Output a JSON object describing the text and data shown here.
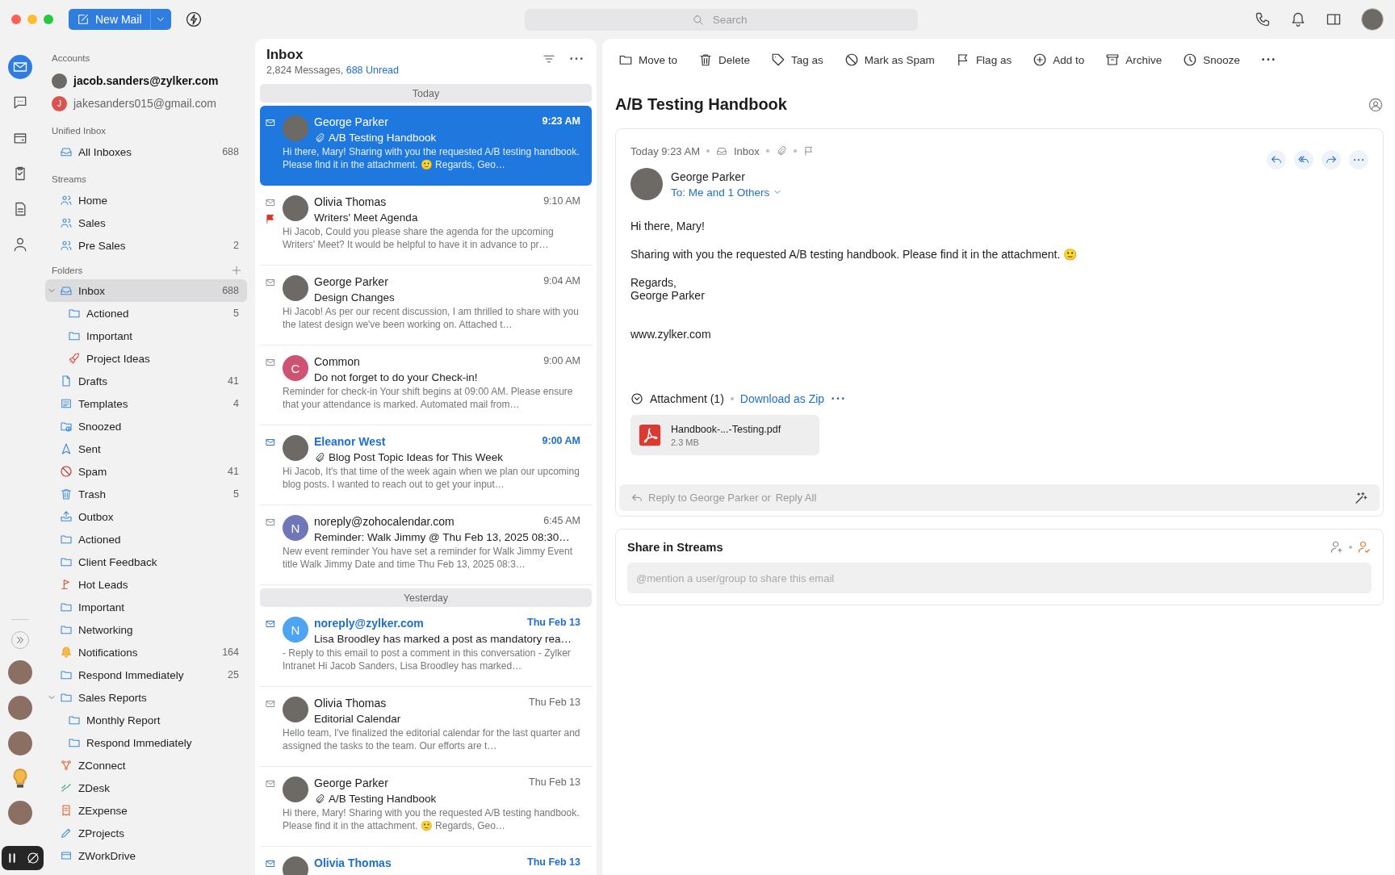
{
  "window": {
    "new_mail": "New Mail",
    "search_placeholder": "Search"
  },
  "rail": [
    {
      "kind": "mail",
      "selected": true
    },
    {
      "kind": "chat",
      "selected": false
    },
    {
      "kind": "calendar",
      "selected": false
    },
    {
      "kind": "tasks",
      "selected": false
    },
    {
      "kind": "notes",
      "selected": false
    },
    {
      "kind": "contacts",
      "selected": false
    }
  ],
  "accounts": {
    "heading": "Accounts",
    "items": [
      {
        "email": "jacob.sanders@zylker.com",
        "selected": true,
        "avatar": {
          "kind": "photo"
        }
      },
      {
        "email": "jakesanders015@gmail.com",
        "selected": false,
        "avatar": {
          "kind": "initial",
          "initial": "J",
          "color": "#d9534f"
        }
      }
    ]
  },
  "unified_inbox": {
    "heading": "Unified Inbox",
    "items": [
      {
        "label": "All Inboxes",
        "count": "688",
        "kind": "tray"
      }
    ]
  },
  "streams": {
    "heading": "Streams",
    "items": [
      {
        "label": "Home",
        "kind": "people"
      },
      {
        "label": "Sales",
        "kind": "people"
      },
      {
        "label": "Pre Sales",
        "count": "2",
        "kind": "people"
      }
    ]
  },
  "folders": {
    "heading": "Folders",
    "items": [
      {
        "label": "Inbox",
        "kind": "tray",
        "count": "688",
        "selected": true,
        "expanded": true,
        "children": [
          {
            "label": "Actioned",
            "kind": "folder",
            "count": "5",
            "selected": false
          },
          {
            "label": "Important",
            "kind": "folder",
            "selected": false
          },
          {
            "label": "Project Ideas",
            "kind": "rocket",
            "selected": false
          }
        ]
      },
      {
        "label": "Drafts",
        "kind": "document",
        "count": "41",
        "selected": false
      },
      {
        "label": "Templates",
        "kind": "list",
        "count": "4",
        "selected": false
      },
      {
        "label": "Snoozed",
        "kind": "snoozed",
        "selected": false
      },
      {
        "label": "Sent",
        "kind": "sent",
        "selected": false
      },
      {
        "label": "Spam",
        "kind": "spam",
        "count": "41",
        "selected": false
      },
      {
        "label": "Trash",
        "kind": "trash",
        "count": "5",
        "selected": false
      },
      {
        "label": "Outbox",
        "kind": "outbox",
        "selected": false
      },
      {
        "label": "Actioned",
        "kind": "folder",
        "selected": false
      },
      {
        "label": "Client Feedback",
        "kind": "folder",
        "selected": false
      },
      {
        "label": "Hot Leads",
        "kind": "golf",
        "selected": false
      },
      {
        "label": "Important",
        "kind": "folder",
        "selected": false
      },
      {
        "label": "Networking",
        "kind": "folder",
        "selected": false
      },
      {
        "label": "Notifications",
        "kind": "bell",
        "count": "164",
        "selected": false
      },
      {
        "label": "Respond Immediately",
        "kind": "folder",
        "count": "25",
        "selected": false
      },
      {
        "label": "Sales Reports",
        "kind": "folder",
        "selected": false,
        "expanded": true,
        "children": [
          {
            "label": "Monthly Report",
            "kind": "folder",
            "selected": false
          },
          {
            "label": "Respond Immediately",
            "kind": "folder",
            "selected": false
          }
        ]
      },
      {
        "label": "ZConnect",
        "kind": "nodes",
        "selected": false
      },
      {
        "label": "ZDesk",
        "kind": "wave",
        "selected": false
      },
      {
        "label": "ZExpense",
        "kind": "receipt",
        "selected": false
      },
      {
        "label": "ZProjects",
        "kind": "pencil",
        "selected": false
      },
      {
        "label": "ZWorkDrive",
        "kind": "drive",
        "selected": false
      }
    ]
  },
  "mail_list": {
    "title": "Inbox",
    "total": "2,824 Messages,",
    "unread": "688 Unread",
    "groups": [
      {
        "label": "Today",
        "messages": [
          {
            "sender": "George Parker",
            "time": "9:23 AM",
            "subject": "A/B Testing Handbook",
            "preview": "Hi there, Mary! Sharing with you the requested A/B testing handbook. Please find it in the attachment. 🙂 Regards, Geo…",
            "selected": true,
            "unread": false,
            "flagged": false,
            "attachment": true,
            "avatar": {
              "kind": "photo"
            }
          },
          {
            "sender": "Olivia Thomas",
            "time": "9:10 AM",
            "subject": "Writers' Meet Agenda",
            "preview": "Hi Jacob, Could you please share the agenda for the upcoming Writers' Meet? It would be helpful to have it in advance to pr…",
            "selected": false,
            "unread": false,
            "flagged": true,
            "attachment": false,
            "avatar": {
              "kind": "photo"
            }
          },
          {
            "sender": "George Parker",
            "time": "9:04 AM",
            "subject": "Design Changes",
            "preview": "Hi Jacob! As per our recent discussion, I am thrilled to share with you the latest design we've been working on. Attached t…",
            "selected": false,
            "unread": false,
            "flagged": false,
            "attachment": false,
            "avatar": {
              "kind": "photo"
            }
          },
          {
            "sender": "Common",
            "time": "9:00 AM",
            "subject": "Do not forget to do your Check-in!",
            "preview": "Reminder for check-in Your shift begins at 09:00 AM. Please ensure that your attendance is marked. Automated mail from…",
            "selected": false,
            "unread": false,
            "flagged": false,
            "attachment": false,
            "avatar": {
              "kind": "initial",
              "initial": "C",
              "color": "#cf5273"
            }
          },
          {
            "sender": "Eleanor West",
            "time": "9:00 AM",
            "subject": "Blog Post Topic Ideas for This Week",
            "preview": "Hi Jacob, It's that time of the week again when we plan our upcoming blog posts. I wanted to reach out to get your input…",
            "selected": false,
            "unread": true,
            "flagged": false,
            "attachment": true,
            "avatar": {
              "kind": "photo"
            }
          },
          {
            "sender": "noreply@zohocalendar.com",
            "time": "6:45 AM",
            "subject": "Reminder: Walk Jimmy @ Thu Feb 13, 2025 08:30…",
            "preview": "New event reminder You have set a reminder for Walk Jimmy Event title Walk Jimmy Date and time Thu Feb 13, 2025 08:3…",
            "selected": false,
            "unread": false,
            "flagged": false,
            "attachment": false,
            "avatar": {
              "kind": "initial",
              "initial": "N",
              "color": "#6f77b8"
            }
          }
        ]
      },
      {
        "label": "Yesterday",
        "messages": [
          {
            "sender": "noreply@zylker.com",
            "time": "Thu Feb 13",
            "subject": "Lisa Broodley has marked a post as mandatory rea…",
            "preview": "- Reply to this email to post a comment in this conversation - Zylker Intranet Hi Jacob Sanders, Lisa Broodley has marked…",
            "selected": false,
            "unread": true,
            "flagged": false,
            "attachment": false,
            "avatar": {
              "kind": "initial",
              "initial": "N",
              "color": "#4ea4f2"
            }
          },
          {
            "sender": "Olivia Thomas",
            "time": "Thu Feb 13",
            "subject": "Editorial Calendar",
            "preview": "Hello team, I've finalized the editorial calendar for the last quarter and assigned the tasks to the team. Our efforts are t…",
            "selected": false,
            "unread": false,
            "flagged": false,
            "attachment": false,
            "avatar": {
              "kind": "photo"
            }
          },
          {
            "sender": "George Parker",
            "time": "Thu Feb 13",
            "subject": "A/B Testing Handbook",
            "preview": "Hi there, Mary! Sharing with you the requested A/B testing handbook. Please find it in the attachment. 🙂 Regards, Geo…",
            "selected": false,
            "unread": false,
            "flagged": false,
            "attachment": true,
            "avatar": {
              "kind": "photo"
            }
          },
          {
            "sender": "Olivia Thomas",
            "time": "Thu Feb 13",
            "selected": false,
            "unread": true,
            "avatar": {
              "kind": "photo"
            }
          }
        ]
      }
    ]
  },
  "toolbar": [
    {
      "label": "Move to",
      "kind": "folder"
    },
    {
      "label": "Delete",
      "kind": "trash"
    },
    {
      "label": "Tag as",
      "kind": "tag"
    },
    {
      "label": "Mark as Spam",
      "kind": "spam"
    },
    {
      "label": "Flag as",
      "kind": "flag"
    },
    {
      "label": "Add to",
      "kind": "add"
    },
    {
      "label": "Archive",
      "kind": "archive"
    },
    {
      "label": "Snooze",
      "kind": "snooze"
    }
  ],
  "message": {
    "subject": "A/B Testing Handbook",
    "date": "Today 9:23 AM",
    "folder": "Inbox",
    "sender": "George Parker",
    "recipients": "To: Me and 1 Others",
    "body": [
      {
        "lines": [
          "Hi there, Mary!"
        ]
      },
      {
        "lines": [
          "Sharing with you the requested A/B testing handbook. Please find it in the attachment. 🙂"
        ]
      },
      {
        "lines": [
          "Regards,",
          "George Parker"
        ]
      },
      {
        "lines": [
          "www.zylker.com"
        ]
      }
    ],
    "attachments": {
      "heading": "Attachment (1)",
      "download": "Download as Zip",
      "files": [
        {
          "name": "Handbook-...-Testing.pdf",
          "size": "2.3 MB"
        }
      ]
    },
    "reply": {
      "prompt": "Reply to George Parker or",
      "reply_all": "Reply All"
    }
  },
  "share": {
    "title": "Share in Streams",
    "placeholder": "@mention a user/group to share this email"
  }
}
